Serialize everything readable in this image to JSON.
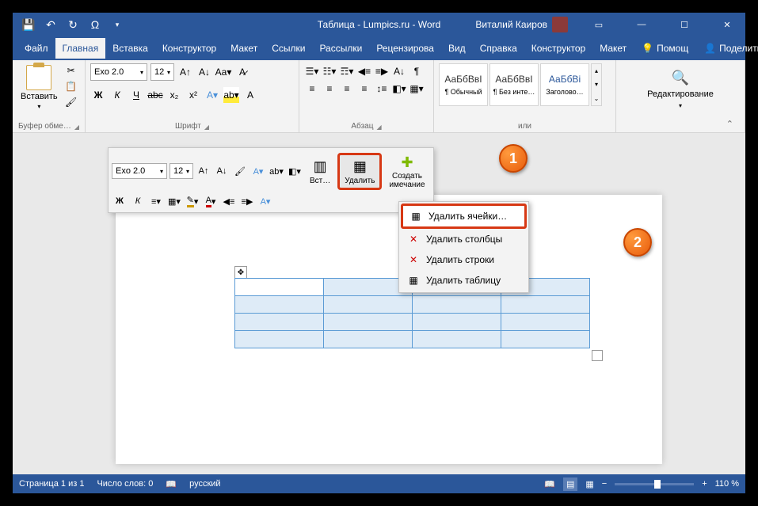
{
  "title": "Таблица - Lumpics.ru - Word",
  "user": "Виталий Каиров",
  "tabs": {
    "file": "Файл",
    "home": "Главная",
    "insert": "Вставка",
    "design": "Конструктор",
    "layout": "Макет",
    "references": "Ссылки",
    "mailings": "Рассылки",
    "review": "Рецензирова",
    "view": "Вид",
    "help": "Справка",
    "tbl_design": "Конструктор",
    "tbl_layout": "Макет"
  },
  "tell_me": "Помощ",
  "share": "Поделиться",
  "ribbon": {
    "paste": "Вставить",
    "clipboard": "Буфер обме…",
    "font_name": "Exo 2.0",
    "font_size": "12",
    "font": "Шрифт",
    "paragraph": "Абзац",
    "styles": "или",
    "editing": "Редактирование",
    "style_normal_preview": "АаБбВвІ",
    "style_normal": "¶ Обычный",
    "style_nospacing_preview": "АаБбВвІ",
    "style_nospacing": "¶ Без инте…",
    "style_heading_preview": "АаБбВі",
    "style_heading": "Заголово…"
  },
  "fmt": {
    "bold": "Ж",
    "italic": "К",
    "underline": "Ч",
    "strike": "abc",
    "sub": "x₂",
    "sup": "x²"
  },
  "mini": {
    "font": "Exo 2.0",
    "size": "12",
    "insert": "Вст…",
    "delete": "Удалить",
    "comment": "Создать",
    "comment2": "имечание"
  },
  "menu": {
    "cells": "Удалить ячейки…",
    "columns": "Удалить столбцы",
    "rows": "Удалить строки",
    "table": "Удалить таблицу"
  },
  "callouts": {
    "one": "1",
    "two": "2"
  },
  "status": {
    "page": "Страница 1 из 1",
    "words": "Число слов: 0",
    "lang": "русский",
    "zoom": "110 %"
  }
}
